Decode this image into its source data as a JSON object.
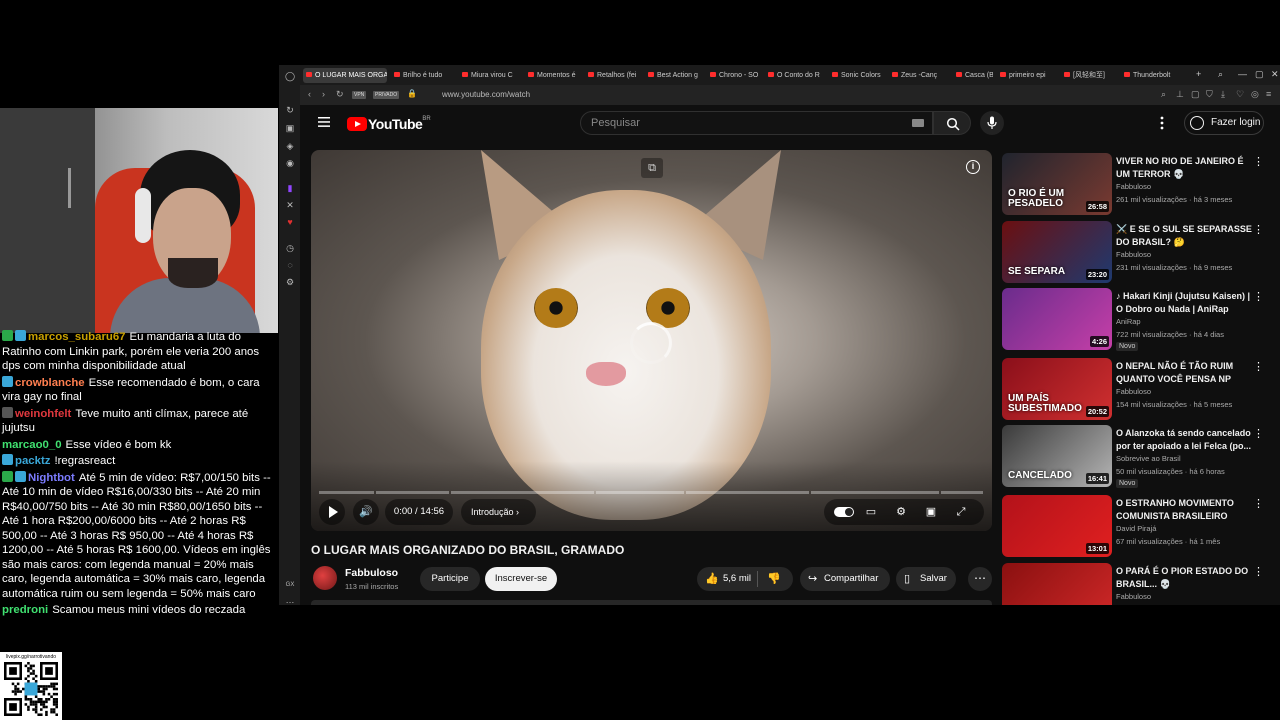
{
  "chat": {
    "messages": [
      {
        "user": "marcos_subaru67",
        "user_color": "#c8a000",
        "badge_colors": [
          "#2ba84a",
          "#3aa7d8"
        ],
        "text": "Eu mandaria a luta do Ratinho com Linkin park, porém ele veria 200 anos dps com minha disponibilidade atual"
      },
      {
        "user": "crowblanche",
        "user_color": "#ff7f50",
        "badge_colors": [
          "#3aa7d8"
        ],
        "text": "Esse recomendado é bom, o cara vira gay no final"
      },
      {
        "user": "weinohfelt",
        "user_color": "#e0383e",
        "badge_colors": [
          "#555555"
        ],
        "text": "Teve muito anti clímax, parece até jujutsu"
      },
      {
        "user": "marcao0_0",
        "user_color": "#40e070",
        "badge_colors": [],
        "text": "Esse vídeo é bom kk"
      },
      {
        "user": "packtz",
        "user_color": "#3aa7d8",
        "badge_colors": [
          "#3aa7d8"
        ],
        "text": "!regrasreact"
      },
      {
        "user": "Nightbot",
        "user_color": "#7c7cff",
        "badge_colors": [
          "#2ba84a",
          "#3aa7d8"
        ],
        "text": "Até 5 min de vídeo: R$7,00/150 bits -- Até 10 min de vídeo R$16,00/330 bits -- Até 20 min R$40,00/750 bits -- Até 30 min R$80,00/1650 bits -- Até 1 hora R$200,00/6000 bits -- Até 2 horas R$ 500,00 -- Até 3 horas R$ 950,00 -- Até 4 horas R$ 1200,00 -- Até 5 horas R$ 1600,00. Vídeos em inglês são mais caros: com legenda manual = 20% mais caro, legenda automática = 30% mais caro, legenda automática ruim ou sem legenda = 50% mais caro"
      },
      {
        "user": "predroni",
        "user_color": "#40e070",
        "badge_colors": [],
        "text": "Scamou meus mini vídeos do reczada"
      }
    ]
  },
  "qr": {
    "caption": "livepix.gg/narrotivando"
  },
  "browser": {
    "tabs": [
      {
        "label": "O LUGAR MAIS ORGAN",
        "active": true
      },
      {
        "label": "Brilho é tudo"
      },
      {
        "label": "Miura virou C"
      },
      {
        "label": "Momentos é"
      },
      {
        "label": "Retalhos (fei"
      },
      {
        "label": "Best Action g"
      },
      {
        "label": "Chrono - SO"
      },
      {
        "label": "O Conto do R"
      },
      {
        "label": "Sonic Colors"
      },
      {
        "label": "Zeus -Canç"
      },
      {
        "label": "Casca (Bers"
      },
      {
        "label": "primeiro epi"
      },
      {
        "label": "[风轻和至]"
      },
      {
        "label": "Thunderbolt"
      }
    ],
    "vpn_label": "VPN",
    "private_label": "PRIVADO",
    "url": "www.youtube.com/watch"
  },
  "youtube": {
    "logo_text": "YouTube",
    "region": "BR",
    "search_placeholder": "Pesquisar",
    "login_label": "Fazer login",
    "player": {
      "time": "0:00 / 14:56",
      "chapter": "Introdução",
      "progress_fraction": 0.0
    },
    "video_title": "O LUGAR MAIS ORGANIZADO DO BRASIL, GRAMADO",
    "channel": {
      "name": "Fabbuloso",
      "subs": "113 mil inscritos"
    },
    "join_label": "Participe",
    "subscribe_label": "Inscrever-se",
    "likes": "5,6 mil",
    "share_label": "Compartilhar",
    "save_label": "Salvar",
    "recommendations": [
      {
        "title": "VIVER NO RIO DE JANEIRO É UM TERROR 💀",
        "channel": "Fabbuloso",
        "meta": "261 mil visualizações · há 3 meses",
        "duration": "26:58",
        "thumb_text": "O RIO É UM PESADELO",
        "thumb_colors": [
          "#20242e",
          "#7a3a30"
        ],
        "new": ""
      },
      {
        "title": "⚔️ E SE O SUL SE SEPARASSE DO BRASIL? 🤔",
        "channel": "Fabbuloso",
        "meta": "231 mil visualizações · há 9 meses",
        "duration": "23:20",
        "thumb_text": "SE SEPARA",
        "thumb_colors": [
          "#6b0f10",
          "#1e3a70"
        ],
        "new": ""
      },
      {
        "title": "♪ Hakari Kinji (Jujutsu Kaisen) | O Dobro ou Nada | AniRap",
        "channel": "AniRap",
        "meta": "722 mil visualizações · há 4 dias",
        "duration": "4:26",
        "thumb_text": "",
        "thumb_colors": [
          "#6a2c8c",
          "#c63fa8"
        ],
        "new": "Novo"
      },
      {
        "title": "O NEPAL NÃO É TÃO RUIM QUANTO VOCÊ PENSA NP",
        "channel": "Fabbuloso",
        "meta": "154 mil visualizações · há 5 meses",
        "duration": "20:52",
        "thumb_text": "UM PAÍS SUBESTIMADO",
        "thumb_colors": [
          "#8a0f1a",
          "#d03030"
        ],
        "new": ""
      },
      {
        "title": "O Alanzoka tá sendo cancelado por ter apoiado a lei Felca (po...",
        "channel": "Sobrevive ao Brasil",
        "meta": "50 mil visualizações · há 6 horas",
        "duration": "16:41",
        "thumb_text": "CANCELADO",
        "thumb_colors": [
          "#3a3a3a",
          "#b5b5b5"
        ],
        "new": "Novo"
      },
      {
        "title": "O ESTRANHO MOVIMENTO COMUNISTA BRASILEIRO",
        "channel": "David Pirajá",
        "meta": "67 mil visualizações · há 1 mês",
        "duration": "13:01",
        "thumb_text": "",
        "thumb_colors": [
          "#b3121a",
          "#e02020"
        ],
        "new": ""
      },
      {
        "title": "O PARÁ É O PIOR ESTADO DO BRASIL... 💀",
        "channel": "Fabbuloso",
        "meta": "",
        "duration": "",
        "thumb_text": "",
        "thumb_colors": [
          "#8a1010",
          "#d02828"
        ],
        "new": ""
      }
    ]
  }
}
